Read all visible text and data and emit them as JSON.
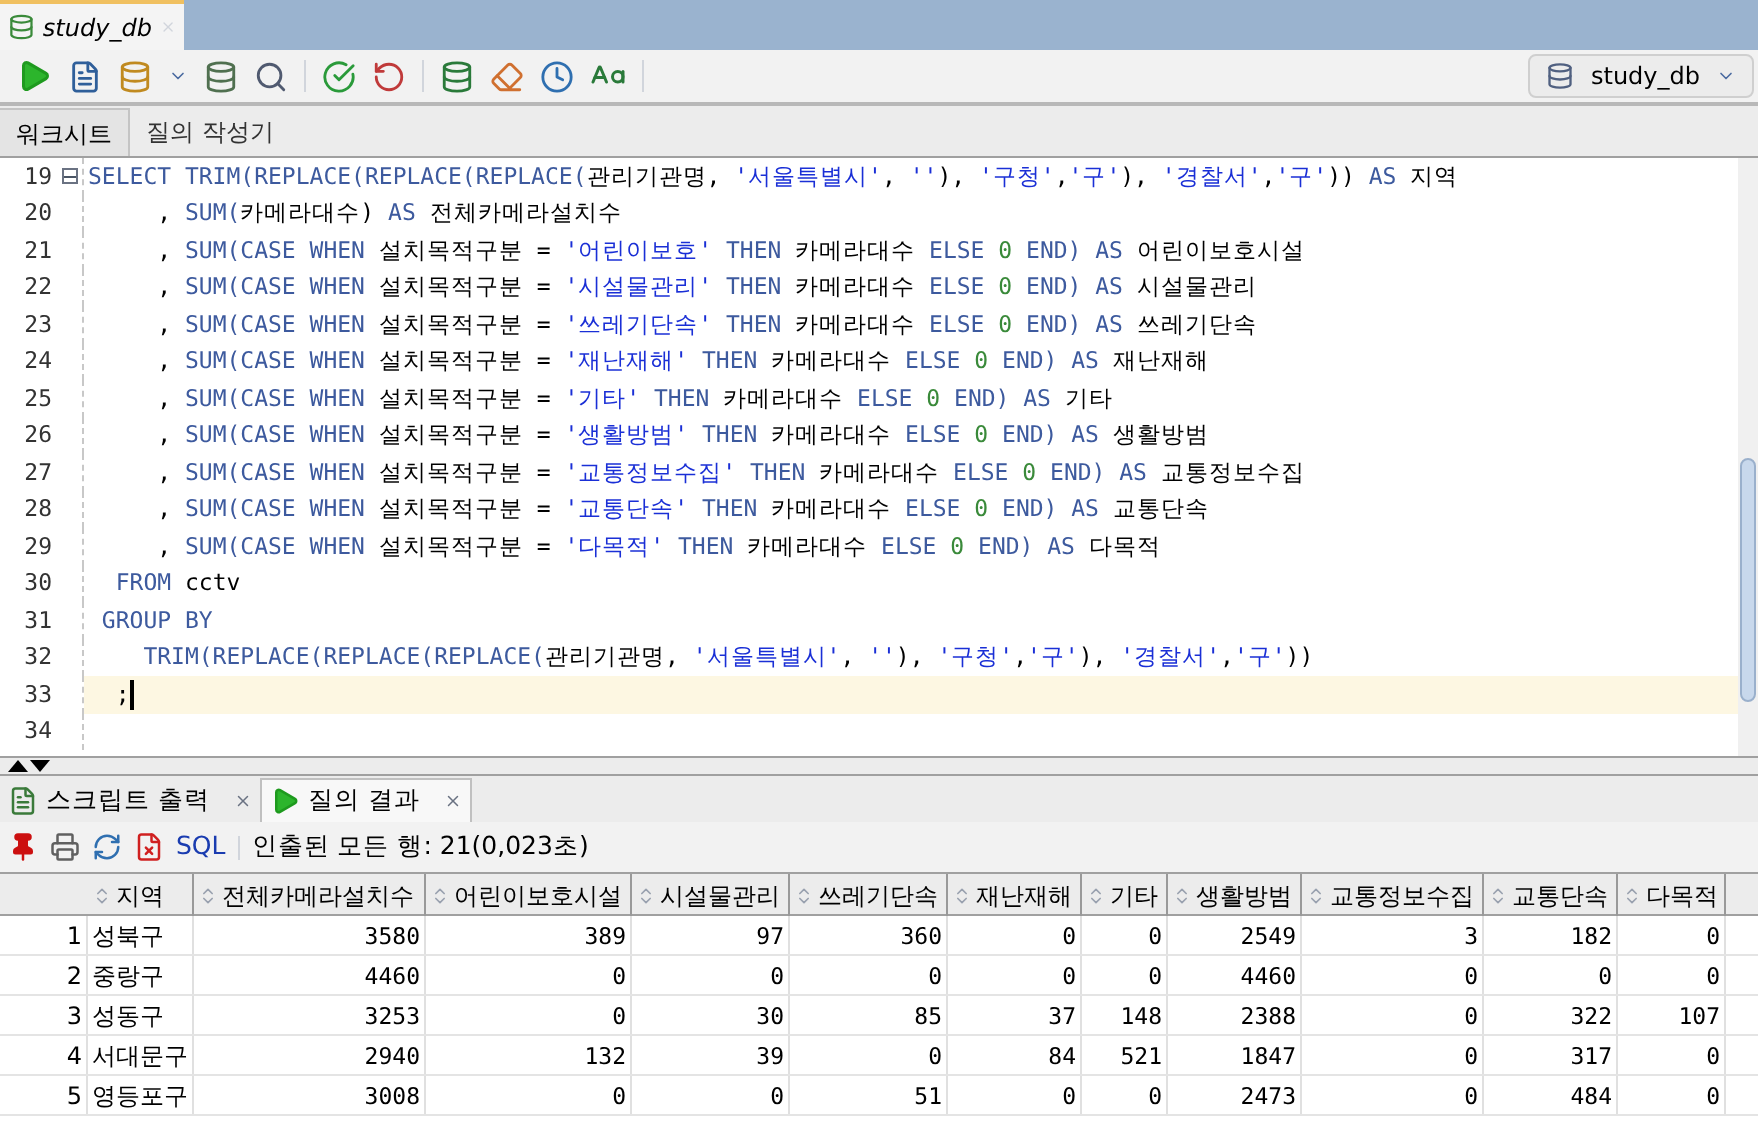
{
  "document_tab": {
    "title": "study_db"
  },
  "connection_selector": {
    "value": "study_db"
  },
  "editor_tabs": [
    {
      "label": "워크시트",
      "selected": true
    },
    {
      "label": "질의 작성기",
      "selected": false
    }
  ],
  "code_lines": [
    {
      "number": "19",
      "foldable": true,
      "current": false,
      "tokens": [
        {
          "kind": "kw",
          "text": "SELECT TRIM(REPLACE(REPLACE(REPLACE("
        },
        {
          "kind": "plain",
          "text": "관리기관명, "
        },
        {
          "kind": "str",
          "text": "'서울특별시'"
        },
        {
          "kind": "plain",
          "text": ", "
        },
        {
          "kind": "str",
          "text": "''"
        },
        {
          "kind": "plain",
          "text": "), "
        },
        {
          "kind": "str",
          "text": "'구청'"
        },
        {
          "kind": "plain",
          "text": ","
        },
        {
          "kind": "str",
          "text": "'구'"
        },
        {
          "kind": "plain",
          "text": "), "
        },
        {
          "kind": "str",
          "text": "'경찰서'"
        },
        {
          "kind": "plain",
          "text": ","
        },
        {
          "kind": "str",
          "text": "'구'"
        },
        {
          "kind": "plain",
          "text": "))"
        },
        {
          "kind": "kw",
          "text": " AS"
        },
        {
          "kind": "plain",
          "text": " 지역"
        }
      ]
    },
    {
      "number": "20",
      "foldable": false,
      "current": false,
      "tokens": [
        {
          "kind": "plain",
          "text": "     ,"
        },
        {
          "kind": "kw",
          "text": " SUM("
        },
        {
          "kind": "plain",
          "text": "카메라대수)"
        },
        {
          "kind": "kw",
          "text": " AS"
        },
        {
          "kind": "plain",
          "text": " 전체카메라설치수"
        }
      ]
    },
    {
      "number": "21",
      "foldable": false,
      "current": false,
      "tokens": [
        {
          "kind": "plain",
          "text": "     ,"
        },
        {
          "kind": "kw",
          "text": " SUM(CASE WHEN"
        },
        {
          "kind": "plain",
          "text": " 설치목적구분 ="
        },
        {
          "kind": "str",
          "text": " '어린이보호'"
        },
        {
          "kind": "kw",
          "text": " THEN"
        },
        {
          "kind": "plain",
          "text": " 카메라대수"
        },
        {
          "kind": "kw",
          "text": " ELSE"
        },
        {
          "kind": "num",
          "text": " 0"
        },
        {
          "kind": "kw",
          "text": " END) AS"
        },
        {
          "kind": "plain",
          "text": " 어린이보호시설"
        }
      ]
    },
    {
      "number": "22",
      "foldable": false,
      "current": false,
      "tokens": [
        {
          "kind": "plain",
          "text": "     ,"
        },
        {
          "kind": "kw",
          "text": " SUM(CASE WHEN"
        },
        {
          "kind": "plain",
          "text": " 설치목적구분 ="
        },
        {
          "kind": "str",
          "text": " '시설물관리'"
        },
        {
          "kind": "kw",
          "text": " THEN"
        },
        {
          "kind": "plain",
          "text": " 카메라대수"
        },
        {
          "kind": "kw",
          "text": " ELSE"
        },
        {
          "kind": "num",
          "text": " 0"
        },
        {
          "kind": "kw",
          "text": " END) AS"
        },
        {
          "kind": "plain",
          "text": " 시설물관리"
        }
      ]
    },
    {
      "number": "23",
      "foldable": false,
      "current": false,
      "tokens": [
        {
          "kind": "plain",
          "text": "     ,"
        },
        {
          "kind": "kw",
          "text": " SUM(CASE WHEN"
        },
        {
          "kind": "plain",
          "text": " 설치목적구분 ="
        },
        {
          "kind": "str",
          "text": " '쓰레기단속'"
        },
        {
          "kind": "kw",
          "text": " THEN"
        },
        {
          "kind": "plain",
          "text": " 카메라대수"
        },
        {
          "kind": "kw",
          "text": " ELSE"
        },
        {
          "kind": "num",
          "text": " 0"
        },
        {
          "kind": "kw",
          "text": " END) AS"
        },
        {
          "kind": "plain",
          "text": " 쓰레기단속"
        }
      ]
    },
    {
      "number": "24",
      "foldable": false,
      "current": false,
      "tokens": [
        {
          "kind": "plain",
          "text": "     ,"
        },
        {
          "kind": "kw",
          "text": " SUM(CASE WHEN"
        },
        {
          "kind": "plain",
          "text": " 설치목적구분 ="
        },
        {
          "kind": "str",
          "text": " '재난재해'"
        },
        {
          "kind": "kw",
          "text": " THEN"
        },
        {
          "kind": "plain",
          "text": " 카메라대수"
        },
        {
          "kind": "kw",
          "text": " ELSE"
        },
        {
          "kind": "num",
          "text": " 0"
        },
        {
          "kind": "kw",
          "text": " END) AS"
        },
        {
          "kind": "plain",
          "text": " 재난재해"
        }
      ]
    },
    {
      "number": "25",
      "foldable": false,
      "current": false,
      "tokens": [
        {
          "kind": "plain",
          "text": "     ,"
        },
        {
          "kind": "kw",
          "text": " SUM(CASE WHEN"
        },
        {
          "kind": "plain",
          "text": " 설치목적구분 ="
        },
        {
          "kind": "str",
          "text": " '기타'"
        },
        {
          "kind": "kw",
          "text": " THEN"
        },
        {
          "kind": "plain",
          "text": " 카메라대수"
        },
        {
          "kind": "kw",
          "text": " ELSE"
        },
        {
          "kind": "num",
          "text": " 0"
        },
        {
          "kind": "kw",
          "text": " END) AS"
        },
        {
          "kind": "plain",
          "text": " 기타"
        }
      ]
    },
    {
      "number": "26",
      "foldable": false,
      "current": false,
      "tokens": [
        {
          "kind": "plain",
          "text": "     ,"
        },
        {
          "kind": "kw",
          "text": " SUM(CASE WHEN"
        },
        {
          "kind": "plain",
          "text": " 설치목적구분 ="
        },
        {
          "kind": "str",
          "text": " '생활방범'"
        },
        {
          "kind": "kw",
          "text": " THEN"
        },
        {
          "kind": "plain",
          "text": " 카메라대수"
        },
        {
          "kind": "kw",
          "text": " ELSE"
        },
        {
          "kind": "num",
          "text": " 0"
        },
        {
          "kind": "kw",
          "text": " END) AS"
        },
        {
          "kind": "plain",
          "text": " 생활방범"
        }
      ]
    },
    {
      "number": "27",
      "foldable": false,
      "current": false,
      "tokens": [
        {
          "kind": "plain",
          "text": "     ,"
        },
        {
          "kind": "kw",
          "text": " SUM(CASE WHEN"
        },
        {
          "kind": "plain",
          "text": " 설치목적구분 ="
        },
        {
          "kind": "str",
          "text": " '교통정보수집'"
        },
        {
          "kind": "kw",
          "text": " THEN"
        },
        {
          "kind": "plain",
          "text": " 카메라대수"
        },
        {
          "kind": "kw",
          "text": " ELSE"
        },
        {
          "kind": "num",
          "text": " 0"
        },
        {
          "kind": "kw",
          "text": " END) AS"
        },
        {
          "kind": "plain",
          "text": " 교통정보수집"
        }
      ]
    },
    {
      "number": "28",
      "foldable": false,
      "current": false,
      "tokens": [
        {
          "kind": "plain",
          "text": "     ,"
        },
        {
          "kind": "kw",
          "text": " SUM(CASE WHEN"
        },
        {
          "kind": "plain",
          "text": " 설치목적구분 ="
        },
        {
          "kind": "str",
          "text": " '교통단속'"
        },
        {
          "kind": "kw",
          "text": " THEN"
        },
        {
          "kind": "plain",
          "text": " 카메라대수"
        },
        {
          "kind": "kw",
          "text": " ELSE"
        },
        {
          "kind": "num",
          "text": " 0"
        },
        {
          "kind": "kw",
          "text": " END) AS"
        },
        {
          "kind": "plain",
          "text": " 교통단속"
        }
      ]
    },
    {
      "number": "29",
      "foldable": false,
      "current": false,
      "tokens": [
        {
          "kind": "plain",
          "text": "     ,"
        },
        {
          "kind": "kw",
          "text": " SUM(CASE WHEN"
        },
        {
          "kind": "plain",
          "text": " 설치목적구분 ="
        },
        {
          "kind": "str",
          "text": " '다목적'"
        },
        {
          "kind": "kw",
          "text": " THEN"
        },
        {
          "kind": "plain",
          "text": " 카메라대수"
        },
        {
          "kind": "kw",
          "text": " ELSE"
        },
        {
          "kind": "num",
          "text": " 0"
        },
        {
          "kind": "kw",
          "text": " END) AS"
        },
        {
          "kind": "plain",
          "text": " 다목적"
        }
      ]
    },
    {
      "number": "30",
      "foldable": false,
      "current": false,
      "tokens": [
        {
          "kind": "kw",
          "text": "  FROM"
        },
        {
          "kind": "plain",
          "text": " cctv"
        }
      ]
    },
    {
      "number": "31",
      "foldable": false,
      "current": false,
      "tokens": [
        {
          "kind": "kw",
          "text": " GROUP BY"
        }
      ]
    },
    {
      "number": "32",
      "foldable": false,
      "current": false,
      "tokens": [
        {
          "kind": "kw",
          "text": "    TRIM(REPLACE(REPLACE(REPLACE("
        },
        {
          "kind": "plain",
          "text": "관리기관명, "
        },
        {
          "kind": "str",
          "text": "'서울특별시'"
        },
        {
          "kind": "plain",
          "text": ", "
        },
        {
          "kind": "str",
          "text": "''"
        },
        {
          "kind": "plain",
          "text": "), "
        },
        {
          "kind": "str",
          "text": "'구청'"
        },
        {
          "kind": "plain",
          "text": ","
        },
        {
          "kind": "str",
          "text": "'구'"
        },
        {
          "kind": "plain",
          "text": "), "
        },
        {
          "kind": "str",
          "text": "'경찰서'"
        },
        {
          "kind": "plain",
          "text": ","
        },
        {
          "kind": "str",
          "text": "'구'"
        },
        {
          "kind": "plain",
          "text": "))"
        }
      ]
    },
    {
      "number": "33",
      "foldable": false,
      "current": true,
      "tokens": [
        {
          "kind": "plain",
          "text": "  ;"
        }
      ]
    },
    {
      "number": "34",
      "foldable": false,
      "current": false
    }
  ],
  "output_tabs": [
    {
      "label": "스크립트 출력",
      "kind": "script",
      "selected": false
    },
    {
      "label": "질의 결과",
      "kind": "query",
      "selected": true
    }
  ],
  "result_toolbar": {
    "sql_link": "SQL",
    "status": "인출된 모든 행: 21(0,023초)"
  },
  "table": {
    "columns": [
      "지역",
      "전체카메라설치수",
      "어린이보호시설",
      "시설물관리",
      "쓰레기단속",
      "재난재해",
      "기타",
      "생활방범",
      "교통정보수집",
      "교통단속",
      "다목적"
    ],
    "rows": [
      {
        "number": "1",
        "cells": [
          "성북구",
          "3580",
          "389",
          "97",
          "360",
          "0",
          "0",
          "2549",
          "3",
          "182",
          "0"
        ]
      },
      {
        "number": "2",
        "cells": [
          "중랑구",
          "4460",
          "0",
          "0",
          "0",
          "0",
          "0",
          "4460",
          "0",
          "0",
          "0"
        ]
      },
      {
        "number": "3",
        "cells": [
          "성동구",
          "3253",
          "0",
          "30",
          "85",
          "37",
          "148",
          "2388",
          "0",
          "322",
          "107"
        ]
      },
      {
        "number": "4",
        "cells": [
          "서대문구",
          "2940",
          "132",
          "39",
          "0",
          "84",
          "521",
          "1847",
          "0",
          "317",
          "0"
        ]
      },
      {
        "number": "5",
        "cells": [
          "영등포구",
          "3008",
          "0",
          "0",
          "51",
          "0",
          "0",
          "2473",
          "0",
          "484",
          "0"
        ]
      }
    ]
  }
}
